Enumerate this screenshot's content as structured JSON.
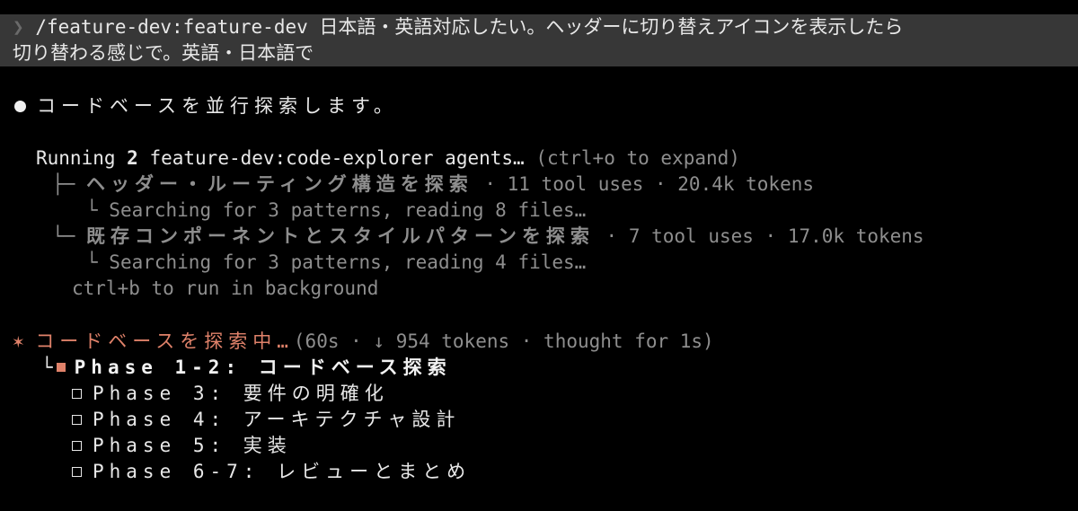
{
  "prompt": {
    "chevron": "❯",
    "line1": "/feature-dev:feature-dev 日本語・英語対応したい。ヘッダーに切り替えアイコンを表示したら",
    "line2": "切り替わる感じで。英語・日本語で"
  },
  "status_message": "コードベースを並行探索します。",
  "agents": {
    "running_prefix": "Running ",
    "running_count": "2",
    "running_suffix": " feature-dev:code-explorer agents…",
    "expand_hint": "(ctrl+o to expand)",
    "tasks": [
      {
        "branch": "├─",
        "name": "ヘッダー・ルーティング構造を探索",
        "stats": " · 11 tool uses · 20.4k tokens",
        "sub_branch": "└",
        "activity": " Searching for 3 patterns, reading 8 files…"
      },
      {
        "branch": "└─",
        "name": "既存コンポーネントとスタイルパターンを探索",
        "stats": " · 7 tool uses · 17.0k tokens",
        "sub_branch": "└",
        "activity": " Searching for 3 patterns, reading 4 files…"
      }
    ],
    "background_hint": "ctrl+b to run in background"
  },
  "progress": {
    "spinner": "✶",
    "label": "コードベースを探索中…",
    "stats": "(60s · ↓ 954 tokens · thought for 1s)"
  },
  "phases": [
    {
      "label": "Phase 1-2: コードベース探索",
      "state": "active"
    },
    {
      "label": "Phase 3: 要件の明確化",
      "state": "pending"
    },
    {
      "label": "Phase 4: アーキテクチャ設計",
      "state": "pending"
    },
    {
      "label": "Phase 5: 実装",
      "state": "pending"
    },
    {
      "label": "Phase 6-7: レビューとまとめ",
      "state": "pending"
    }
  ],
  "colors": {
    "background": "#000000",
    "prompt_background": "#373737",
    "accent": "#e0826a",
    "dim": "#8e8e8e",
    "text": "#e8e8e8"
  }
}
